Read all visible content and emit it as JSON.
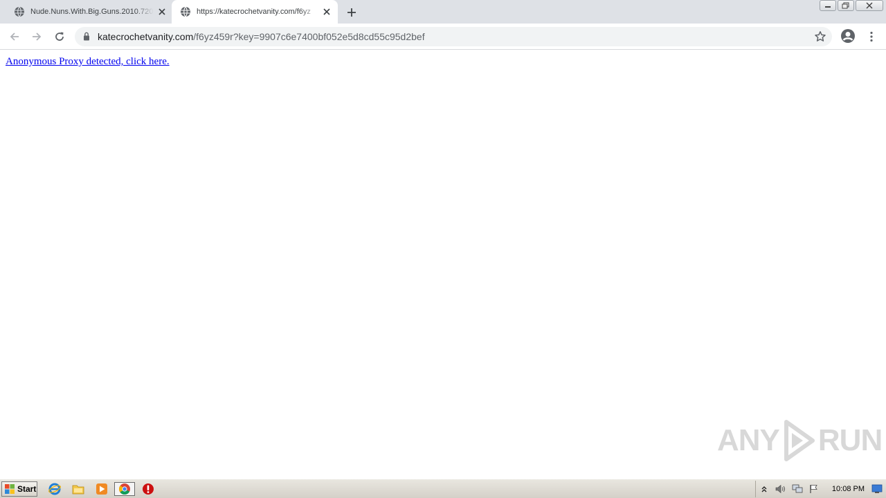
{
  "tabs": [
    {
      "title": "Nude.Nuns.With.Big.Guns.2010.720",
      "icon": "globe-icon",
      "active": false
    },
    {
      "title": "https://katecrochetvanity.com/f6yz",
      "icon": "globe-icon",
      "active": true
    }
  ],
  "address_bar": {
    "host": "katecrochetvanity.com",
    "path": "/f6yz459r?key=9907c6e7400bf052e5d8cd55c95d2bef"
  },
  "page": {
    "link_text": "Anonymous Proxy detected, click here."
  },
  "watermark": {
    "text_left": "ANY",
    "text_right": "RUN"
  },
  "taskbar": {
    "start_label": "Start",
    "clock": "10:08 PM"
  },
  "colors": {
    "tabstrip": "#dee1e6",
    "omnibox": "#f1f3f4",
    "link": "#0000ee",
    "taskbar": "#d4d0c8"
  }
}
